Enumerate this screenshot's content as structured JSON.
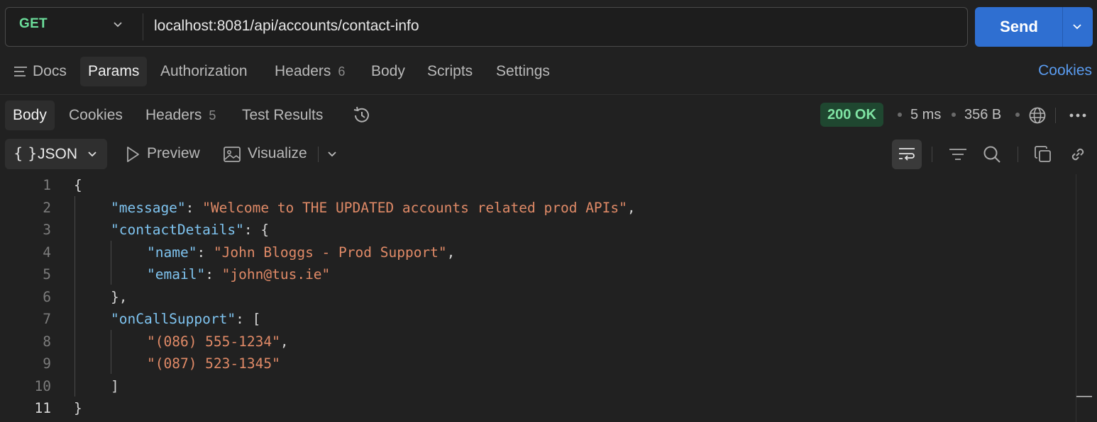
{
  "request": {
    "method": "GET",
    "url": "localhost:8081/api/accounts/contact-info",
    "send_label": "Send"
  },
  "request_tabs": {
    "docs": "Docs",
    "params": "Params",
    "authorization": "Authorization",
    "headers": "Headers",
    "headers_count": "6",
    "body": "Body",
    "scripts": "Scripts",
    "settings": "Settings",
    "cookies": "Cookies"
  },
  "response_tabs": {
    "body": "Body",
    "cookies": "Cookies",
    "headers": "Headers",
    "headers_count": "5",
    "test_results": "Test Results"
  },
  "response_meta": {
    "status": "200 OK",
    "time": "5 ms",
    "size": "356 B"
  },
  "toolbar": {
    "format_braces": "{ }",
    "format": "JSON",
    "preview": "Preview",
    "visualize": "Visualize"
  },
  "editor": {
    "line_numbers": [
      "1",
      "2",
      "3",
      "4",
      "5",
      "6",
      "7",
      "8",
      "9",
      "10",
      "11"
    ],
    "message_key": "\"message\"",
    "message_value": "\"Welcome to THE UPDATED accounts related prod APIs\"",
    "contact_key": "\"contactDetails\"",
    "name_key": "\"name\"",
    "name_value": "\"John Bloggs - Prod Support\"",
    "email_key": "\"email\"",
    "email_value": "\"john@tus.ie\"",
    "oncall_key": "\"onCallSupport\"",
    "phone1": "\"(086) 555-1234\"",
    "phone2": "\"(087) 523-1345\""
  },
  "colors": {
    "send_button": "#2f6fd1",
    "status_ok": "#7fe3a3",
    "json_key": "#7fc4f0",
    "json_string": "#e08a67",
    "link": "#5a9cf0"
  }
}
